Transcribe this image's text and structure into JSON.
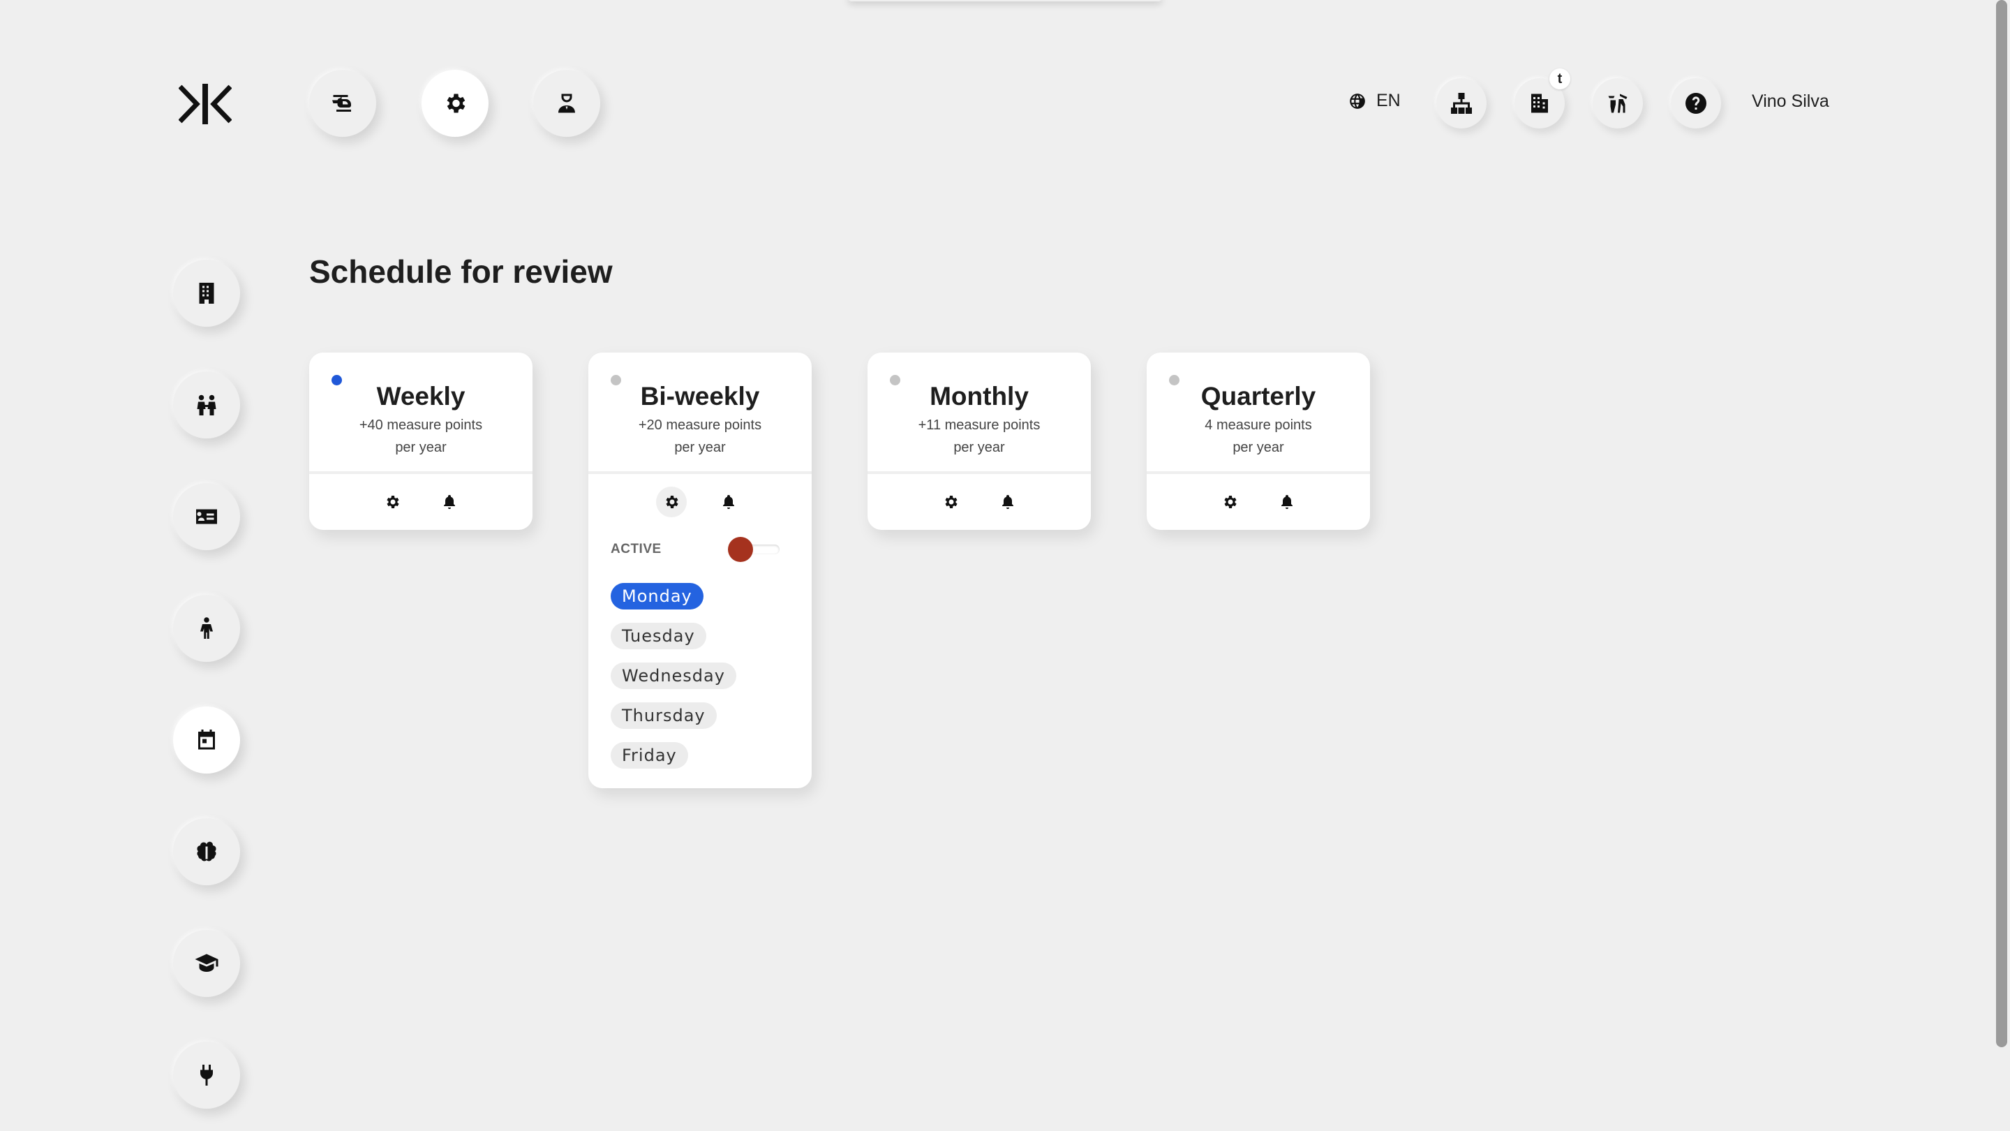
{
  "header": {
    "nav_icons": [
      "helicopter-icon",
      "gear-icon",
      "user-icon"
    ],
    "language": "EN",
    "badge": "t",
    "user_name": "Vino Silva"
  },
  "sidebar": {
    "items": [
      "building-icon",
      "people-icon",
      "id-card-icon",
      "person-icon",
      "calendar-icon",
      "brain-icon",
      "graduation-cap-icon",
      "plug-icon"
    ]
  },
  "page": {
    "title": "Schedule for review"
  },
  "cards": [
    {
      "title": "Weekly",
      "line1": "+40 measure points",
      "line2": "per year",
      "selected": true
    },
    {
      "title": "Bi-weekly",
      "line1": "+20 measure points",
      "line2": "per year",
      "selected": false,
      "active_label": "ACTIVE",
      "days": [
        "Monday",
        "Tuesday",
        "Wednesday",
        "Thursday",
        "Friday"
      ],
      "selected_day": "Monday"
    },
    {
      "title": "Monthly",
      "line1": "+11 measure points",
      "line2": "per year",
      "selected": false
    },
    {
      "title": "Quarterly",
      "line1": "4 measure points",
      "line2": "per year",
      "selected": false
    }
  ],
  "colors": {
    "background": "#efefef",
    "accent_blue": "#2463e0",
    "toggle_knob": "#a5321e"
  }
}
